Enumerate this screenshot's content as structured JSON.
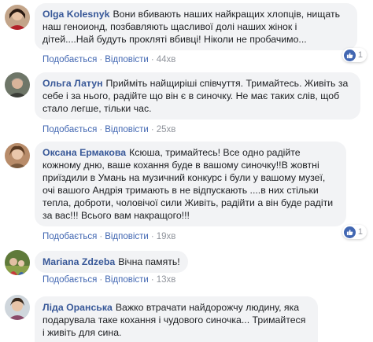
{
  "comments": [
    {
      "author": "Olga Kolesnyk",
      "text": "Вони вбивають наших найкращих хлопців, нищать наш геноионд, позбавляють щасливої долі наших жінок і дітей....Най будуть прокляті вбивці! Ніколи не пробачимо...",
      "like": "Подобається",
      "reply": "Відповісти",
      "time": "44хв",
      "reactions": "1"
    },
    {
      "author": "Ольга Латун",
      "text": "Прийміть найщиріші співчуття. Тримайтесь. Живіть за себе і за нього, радійте що він є в синочку. Не має таких слів, щоб стало легше, тільки час.",
      "like": "Подобається",
      "reply": "Відповісти",
      "time": "25хв"
    },
    {
      "author": "Оксана Ермакова",
      "text": "Ксюша, тримайтесь! Все одно радійте кожному дню, ваше кохання буде в вашому синочку!!В жовтні приїздили в Умань на музичний конкурс і були у вашому музеї, очі вашого Андрія тримають в не відпускають ....в них стільки тепла, доброти, чоловічої сили Живіть, радійти а він буде радіти за вас!!! Всього вам накращого!!!",
      "like": "Подобається",
      "reply": "Відповісти",
      "time": "19хв",
      "reactions": "1"
    },
    {
      "author": "Mariana Zdzeba",
      "text": "Вічна память!",
      "like": "Подобається",
      "reply": "Відповісти",
      "time": "13хв"
    },
    {
      "author": "Ліда Оранська",
      "text": "Важко втрачати найдорожчу людину, яка подарувала таке кохання і чудового синочка... Тримайтеся і живіть для сина."
    }
  ],
  "colors": {
    "link": "#385898",
    "action": "#4267b2",
    "bubble": "#f2f3f5",
    "meta": "#90949c"
  },
  "icons": [
    "avatar",
    "like-thumb-icon"
  ]
}
